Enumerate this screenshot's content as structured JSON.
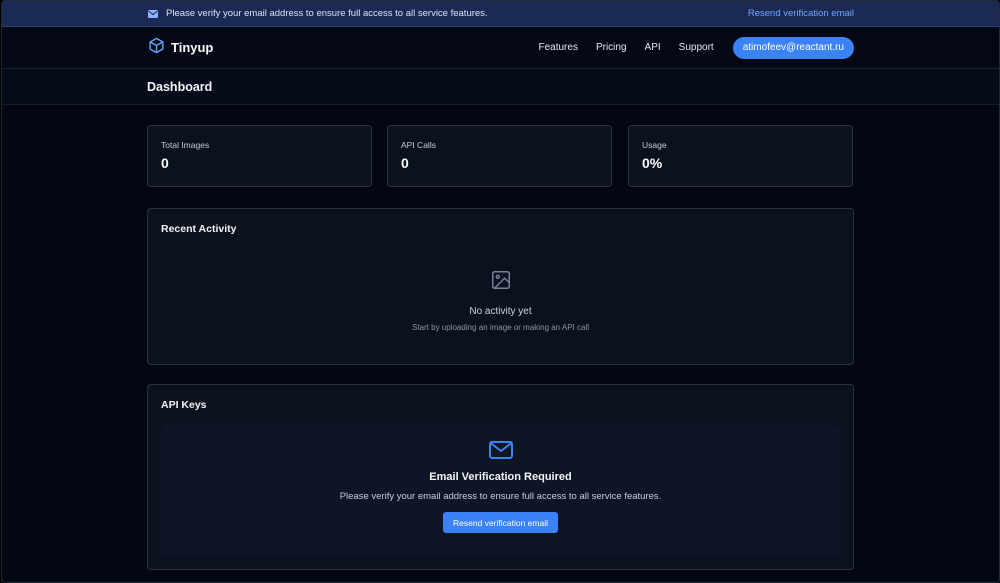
{
  "banner": {
    "message": "Please verify your email address to ensure full access to all service features.",
    "link": "Resend verification email",
    "icon": "mail-icon"
  },
  "nav": {
    "brand": "Tinyup",
    "links": [
      "Features",
      "Pricing",
      "API",
      "Support"
    ],
    "user_email": "atimofeev@reactant.ru"
  },
  "page": {
    "title": "Dashboard"
  },
  "stats": [
    {
      "label": "Total Images",
      "value": "0"
    },
    {
      "label": "API Calls",
      "value": "0"
    },
    {
      "label": "Usage",
      "value": "0%"
    }
  ],
  "recent_activity": {
    "title": "Recent Activity",
    "empty_title": "No activity yet",
    "empty_sub": "Start by uploading an image or making an API call"
  },
  "api_keys": {
    "title": "API Keys",
    "verify_title": "Email Verification Required",
    "verify_message": "Please verify your email address to ensure full access to all service features.",
    "verify_button": "Resend verification email"
  },
  "colors": {
    "accent": "#3b82f6",
    "banner_bg": "#1a2a55",
    "link": "#6ea8ff",
    "background": "#030712",
    "card_bg": "#0b111f"
  }
}
